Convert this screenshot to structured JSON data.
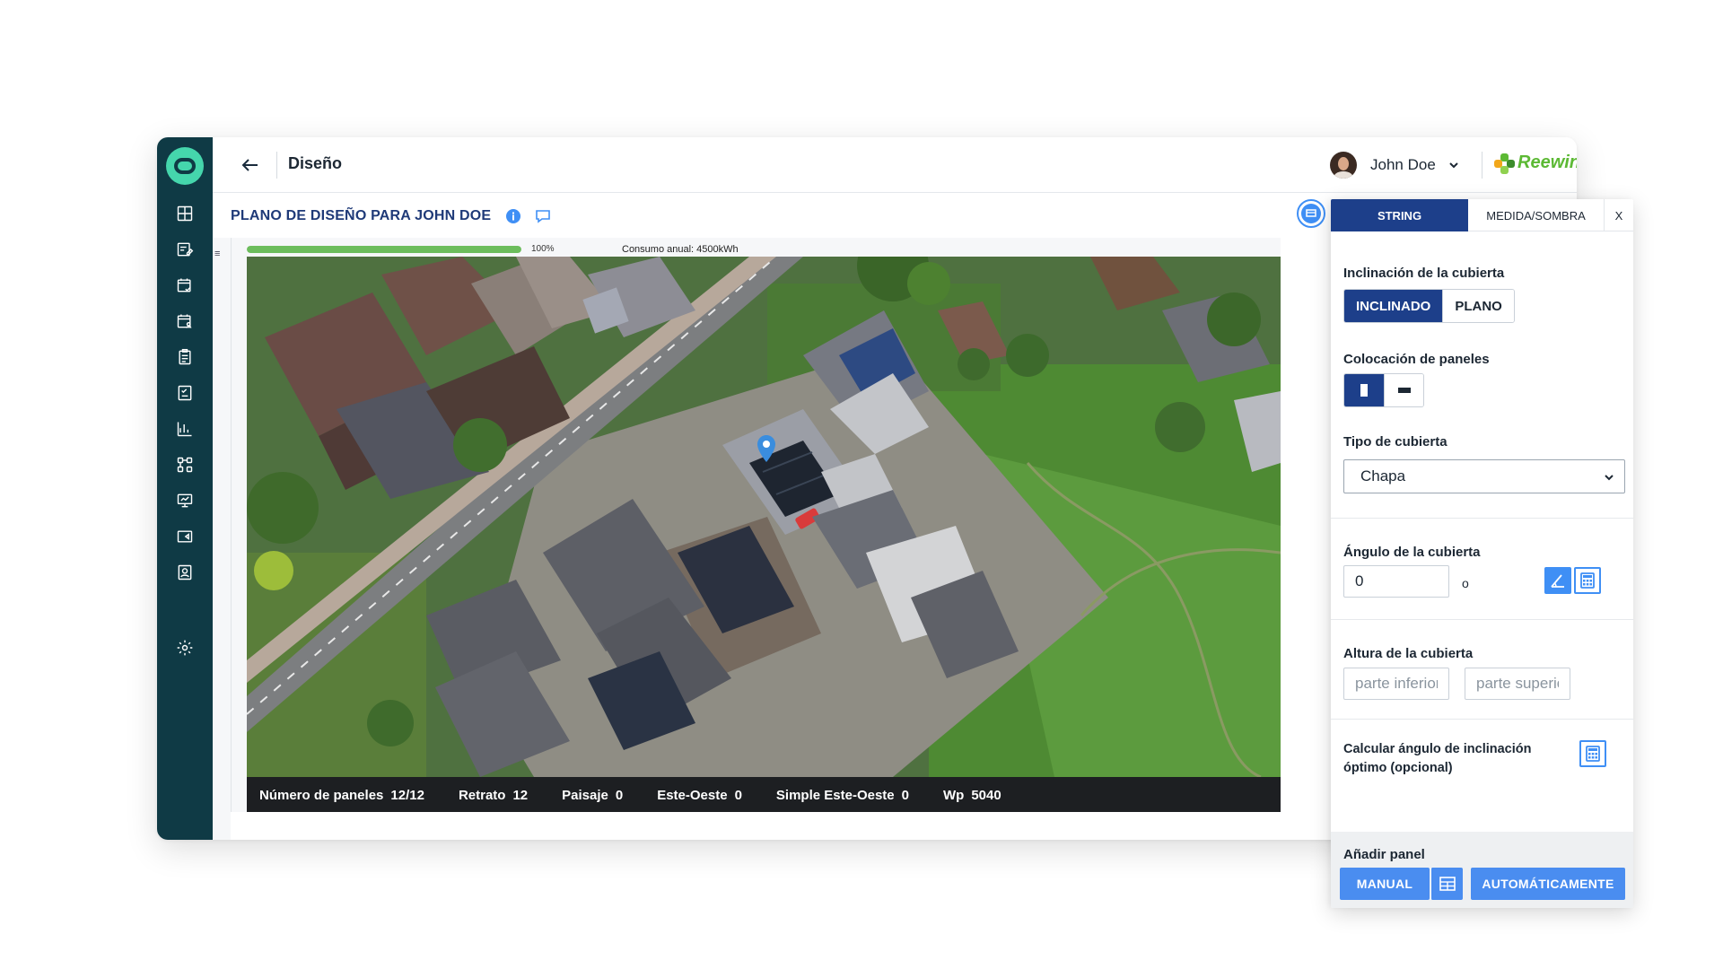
{
  "header": {
    "page_title": "Diseño",
    "user_name": "John Doe",
    "brand_name": "Reewinewe"
  },
  "subheader": {
    "plan_title": "PLANO DE DISEÑO PARA JOHN DOE"
  },
  "workspace": {
    "menu_glyph": "≡",
    "progress": {
      "percent_label": "100%",
      "fraction": 1.0
    },
    "consumo_label": "Consumo anual: 4500kWh"
  },
  "stats": [
    {
      "label": "Número de paneles",
      "value": "12/12"
    },
    {
      "label": "Retrato",
      "value": "12"
    },
    {
      "label": "Paisaje",
      "value": "0"
    },
    {
      "label": "Este-Oeste",
      "value": "0"
    },
    {
      "label": "Simple Este-Oeste",
      "value": "0"
    },
    {
      "label": "Wp",
      "value": "5040"
    }
  ],
  "panel": {
    "tabs": [
      "STRING",
      "MEDIDA/SOMBRA",
      "X"
    ],
    "roof_tilt": {
      "label": "Inclinación de la cubierta",
      "options": [
        "INCLINADO",
        "PLANO"
      ]
    },
    "placement": {
      "label": "Colocación de paneles"
    },
    "roof_type": {
      "label": "Tipo de cubierta",
      "value": "Chapa"
    },
    "roof_angle": {
      "label": "Ángulo de la cubierta",
      "value": "0",
      "unit": "o"
    },
    "roof_height": {
      "label": "Altura de la cubierta",
      "lower_placeholder": "parte inferior",
      "upper_placeholder": "parte superior"
    },
    "optimal": {
      "label_line1": "Calcular ángulo de inclinación",
      "label_line2": "óptimo (opcional)"
    },
    "add_panel": {
      "label": "Añadir panel",
      "manual": "MANUAL",
      "auto": "AUTOMÁTICAMENTE"
    }
  },
  "colors": {
    "sidebar": "#0f3a45",
    "accent_navy": "#1d3f8a",
    "accent_blue": "#3f8ff5",
    "logo_green": "#45d6ac",
    "brand_green": "#5cb934",
    "progress_green": "#6cbd5c"
  },
  "icons": {
    "sidebar": [
      "dashboard-icon",
      "edit-list-icon",
      "calendar-check-icon",
      "calendar-user-icon",
      "clipboard-icon",
      "checklist-icon",
      "bar-chart-icon",
      "network-icon",
      "presentation-icon",
      "ticket-icon",
      "contact-card-icon",
      "gear-icon"
    ]
  }
}
